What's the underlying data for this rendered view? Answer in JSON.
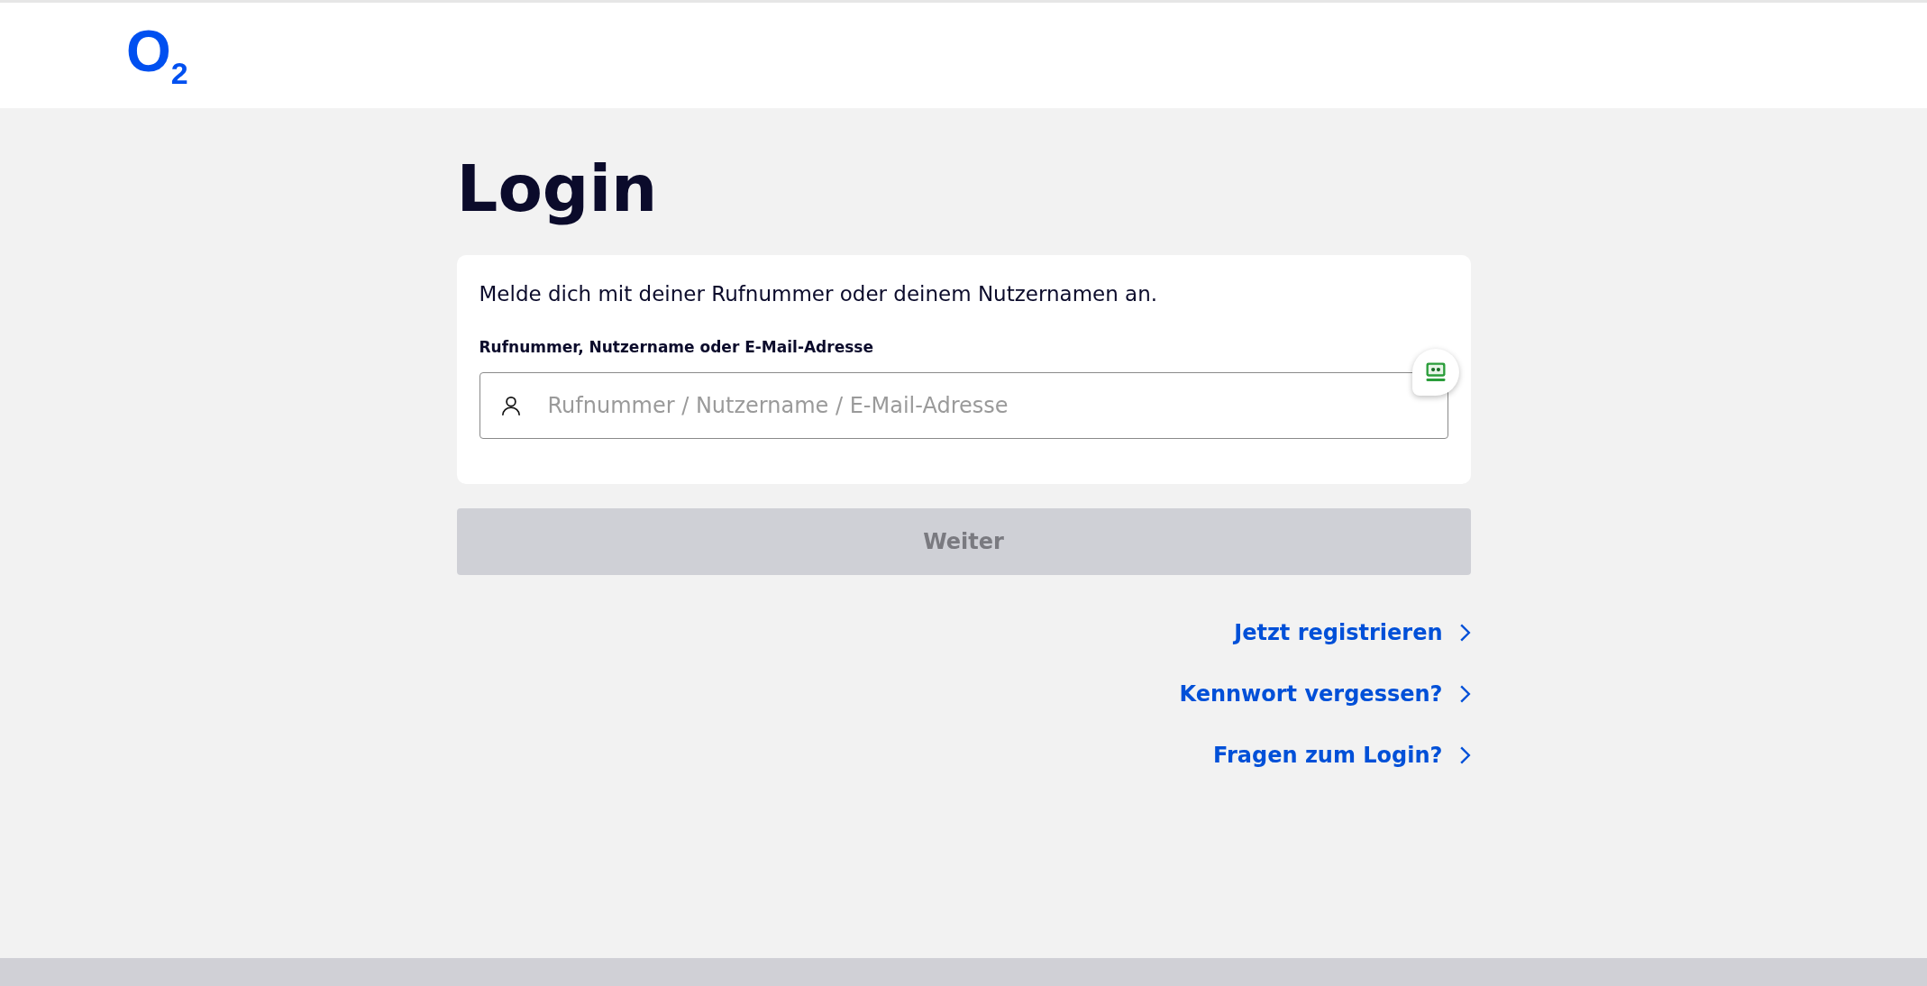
{
  "header": {
    "logo": "O$_{2}$"
  },
  "title": "Login",
  "card": {
    "intro": "Melde dich mit deiner Rufnummer oder deinem Nutzernamen an.",
    "field": {
      "label": "Rufnummer, Nutzername oder E-Mail-Adresse",
      "placeholder": "Rufnummer / Nutzername / E-Mail-Adresse"
    }
  },
  "submit": {
    "label": "Weiter",
    "disabled": true
  },
  "links": [
    {
      "label": "Jetzt registrieren"
    },
    {
      "label": "Kennwort vergessen?"
    },
    {
      "label": "Fragen zum Login?"
    }
  ]
}
